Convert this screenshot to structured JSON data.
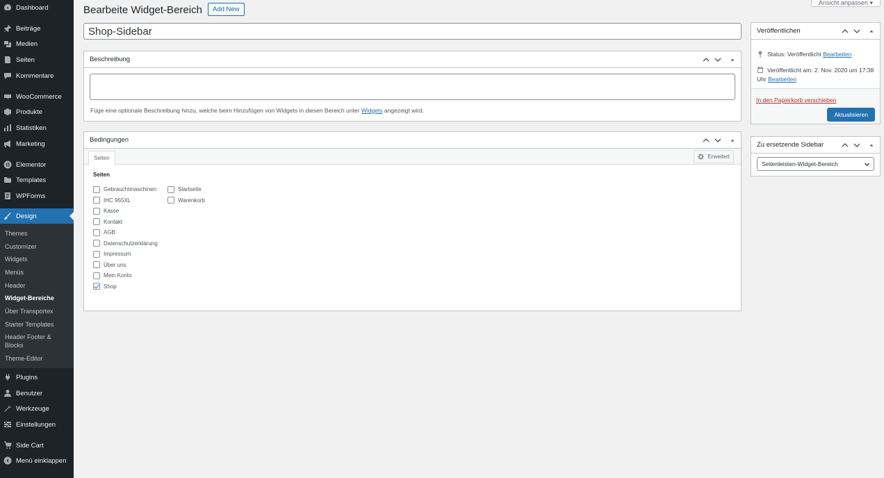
{
  "sidebar": {
    "items": [
      {
        "label": "Dashboard",
        "icon": "dashboard-icon"
      },
      {
        "label": "Beiträge",
        "icon": "pin-icon"
      },
      {
        "label": "Medien",
        "icon": "media-icon"
      },
      {
        "label": "Seiten",
        "icon": "page-icon"
      },
      {
        "label": "Kommentare",
        "icon": "comment-icon"
      },
      {
        "label": "WooCommerce",
        "icon": "woocommerce-icon"
      },
      {
        "label": "Produkte",
        "icon": "box-icon"
      },
      {
        "label": "Statistiken",
        "icon": "bar-chart-icon"
      },
      {
        "label": "Marketing",
        "icon": "megaphone-icon"
      },
      {
        "label": "Elementor",
        "icon": "elementor-icon"
      },
      {
        "label": "Templates",
        "icon": "folder-icon"
      },
      {
        "label": "WPForms",
        "icon": "form-icon"
      },
      {
        "label": "Design",
        "icon": "brush-icon"
      },
      {
        "label": "Plugins",
        "icon": "plug-icon"
      },
      {
        "label": "Benutzer",
        "icon": "user-icon"
      },
      {
        "label": "Werkzeuge",
        "icon": "wrench-icon"
      },
      {
        "label": "Einstellungen",
        "icon": "settings-icon"
      },
      {
        "label": "Side Cart",
        "icon": "cart-icon"
      },
      {
        "label": "Menü einklappen",
        "icon": "collapse-icon"
      }
    ],
    "submenu": [
      "Themes",
      "Customizer",
      "Widgets",
      "Menüs",
      "Header",
      "Widget-Bereiche",
      "Über Transportex",
      "Starter Templates",
      "Header Footer & Blocks",
      "Theme-Editor"
    ]
  },
  "header": {
    "title": "Bearbeite Widget-Bereich",
    "add_new": "Add New",
    "screen_options": "Ansicht anpassen ▾"
  },
  "title_input": {
    "value": "Shop-Sidebar"
  },
  "description_box": {
    "title": "Beschreibung",
    "help_before": "Füge eine optionale Beschreibung hinzu, welche beim Hinzufügen von Widgets in diesen Bereich unter ",
    "help_link": "Widgets",
    "help_after": " angezeigt wird."
  },
  "conditions_box": {
    "title": "Bedingungen",
    "tab": "Seiten",
    "advanced": "Erweitert",
    "pages_heading": "Seiten",
    "col1": [
      {
        "label": "Gebrauchtmaschinen",
        "checked": false
      },
      {
        "label": "IHC 955XL",
        "checked": false
      },
      {
        "label": "Kasse",
        "checked": false
      },
      {
        "label": "Kontakt",
        "checked": false
      },
      {
        "label": "AGB",
        "checked": false
      },
      {
        "label": "Datenschutzerklärung",
        "checked": false
      },
      {
        "label": "Impressum",
        "checked": false
      },
      {
        "label": "Über uns",
        "checked": false
      },
      {
        "label": "Mein Konto",
        "checked": false
      },
      {
        "label": "Shop",
        "checked": true
      }
    ],
    "col2": [
      {
        "label": "Startseite",
        "checked": false
      },
      {
        "label": "Warenkorb",
        "checked": false
      }
    ]
  },
  "publish_box": {
    "title": "Veröffentlichen",
    "status_label": "Status: Veröffentlicht",
    "status_edit": "Bearbeiten",
    "date_label": "Veröffentlicht am: 2. Nov. 2020 um 17:38 Uhr",
    "date_edit": "Bearbeiten",
    "trash": "In den Papierkorb verschieben",
    "update": "Aktualisieren"
  },
  "replace_box": {
    "title": "Zu ersetzende Sidebar",
    "selected": "Seitenleisten-Widget-Bereich"
  },
  "colors": {
    "sidebar_bg": "#1d2327",
    "accent": "#2271b1",
    "trash": "#b32d2e"
  }
}
